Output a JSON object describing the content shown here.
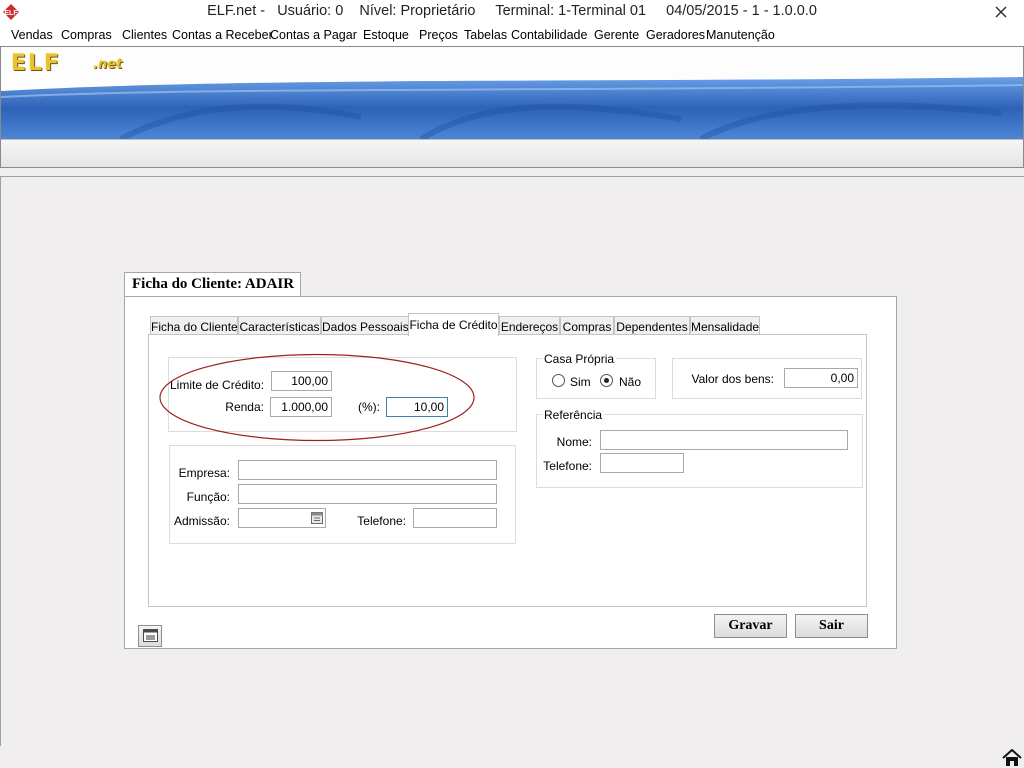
{
  "window": {
    "title": "ELF.net -   Usuário: 0    Nível: Proprietário     Terminal: 1-Terminal 01     04/05/2015 - 1 - 1.0.0.0",
    "icon": "elf-app-icon",
    "close_icon": "close-icon"
  },
  "menu": [
    "Vendas",
    "Compras",
    "Clientes",
    "Contas a Receber",
    "Contas a Pagar",
    "Estoque",
    "Preços",
    "Tabelas",
    "Contabilidade",
    "Gerente",
    "Geradores",
    "Manutenção"
  ],
  "banner": {
    "logo": "ELF",
    "logo_suffix": ".net"
  },
  "dialog": {
    "title": "Ficha do Cliente: ADAIR",
    "tabs": [
      "Ficha do Cliente",
      "Características",
      "Dados Pessoais",
      "Ficha de Crédito",
      "Endereços",
      "Compras",
      "Dependentes",
      "Mensalidade"
    ],
    "active_tab": "Ficha de Crédito",
    "credit": {
      "limite_label": "Limite de Crédito:",
      "limite_value": "100,00",
      "renda_label": "Renda:",
      "renda_value": "1.000,00",
      "pct_label": "(%):",
      "pct_value": "10,00"
    },
    "work": {
      "empresa_label": "Empresa:",
      "empresa_value": "",
      "funcao_label": "Função:",
      "funcao_value": "",
      "admissao_label": "Admissão:",
      "admissao_value": "",
      "telefone_label": "Telefone:",
      "telefone_value": ""
    },
    "casa_propria": {
      "legend": "Casa Própria",
      "options": [
        "Sim",
        "Não"
      ],
      "selected": "Não"
    },
    "bens": {
      "label": "Valor dos bens:",
      "value": "0,00"
    },
    "referencia": {
      "legend": "Referência",
      "nome_label": "Nome:",
      "nome_value": "",
      "telefone_label": "Telefone:",
      "telefone_value": ""
    },
    "buttons": {
      "gravar": "Gravar",
      "sair": "Sair"
    },
    "small_icon": "window-icon"
  },
  "taskbar_icon": "home-icon",
  "colors": {
    "highlight_ellipse": "#a02020",
    "banner_blue": "#3a6fc0",
    "logo_gold": "#e8c233"
  }
}
